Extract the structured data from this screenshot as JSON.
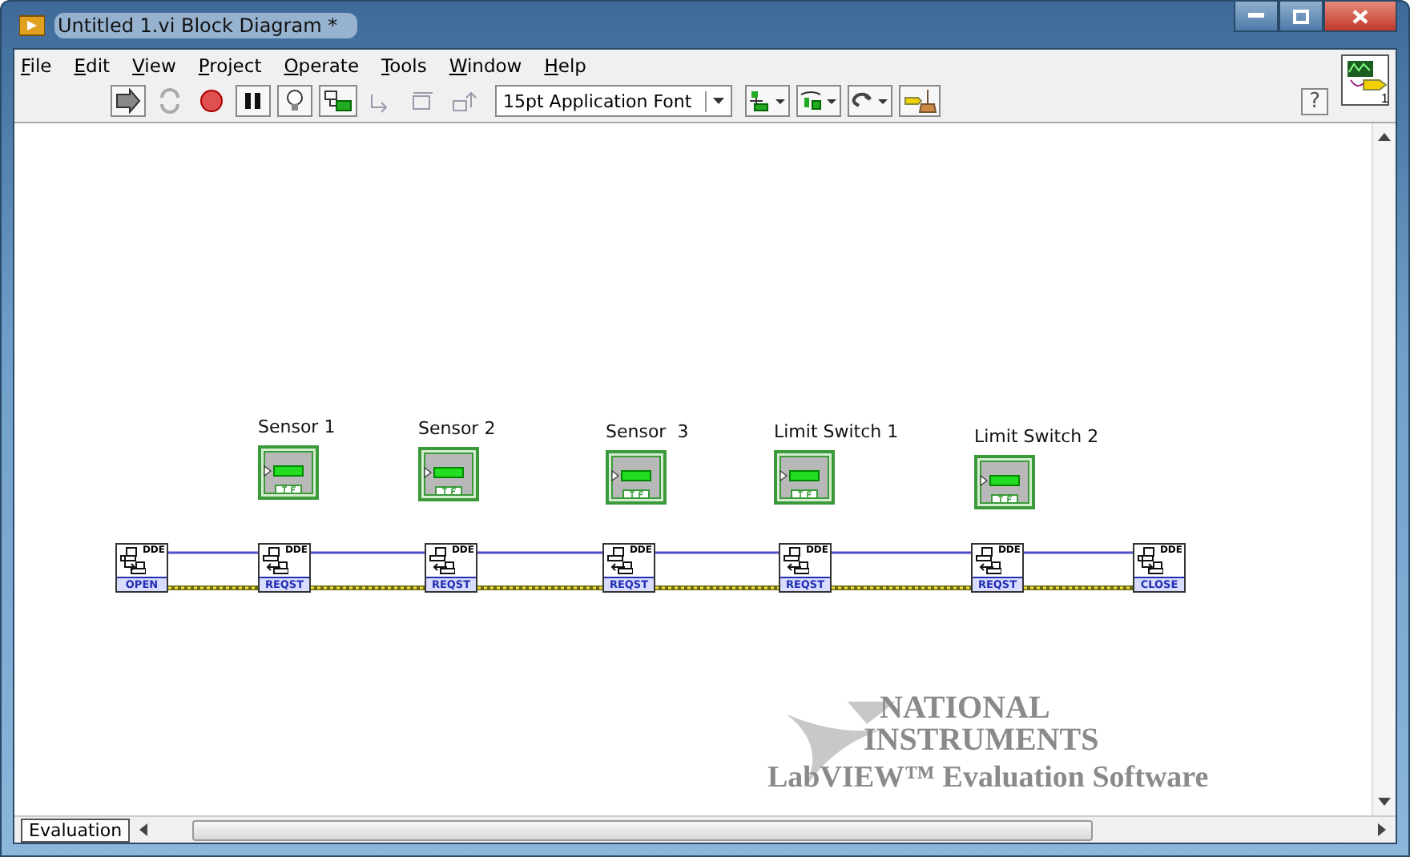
{
  "window": {
    "title": "Untitled 1.vi Block Diagram *"
  },
  "menu": [
    {
      "label": "File"
    },
    {
      "label": "Edit"
    },
    {
      "label": "View"
    },
    {
      "label": "Project"
    },
    {
      "label": "Operate"
    },
    {
      "label": "Tools"
    },
    {
      "label": "Window"
    },
    {
      "label": "Help"
    }
  ],
  "toolbar": {
    "font": "15pt Application Font",
    "help": "?",
    "connector_pane": "1"
  },
  "diagram": {
    "indicators": [
      {
        "label": "Sensor 1"
      },
      {
        "label": "Sensor 2"
      },
      {
        "label": "Sensor  3"
      },
      {
        "label": "Limit Switch 1"
      },
      {
        "label": "Limit Switch 2"
      }
    ],
    "dde_nodes": [
      {
        "tag": "DDE",
        "caption": "OPEN"
      },
      {
        "tag": "DDE",
        "caption": "REQST"
      },
      {
        "tag": "DDE",
        "caption": "REQST"
      },
      {
        "tag": "DDE",
        "caption": "REQST"
      },
      {
        "tag": "DDE",
        "caption": "REQST"
      },
      {
        "tag": "DDE",
        "caption": "REQST"
      },
      {
        "tag": "DDE",
        "caption": "CLOSE"
      }
    ]
  },
  "watermark": {
    "lines": [
      "NATIONAL",
      "INSTRUMENTS",
      "LabVIEW™ Evaluation Software"
    ]
  },
  "status_bar": {
    "context": "Evaluation"
  }
}
